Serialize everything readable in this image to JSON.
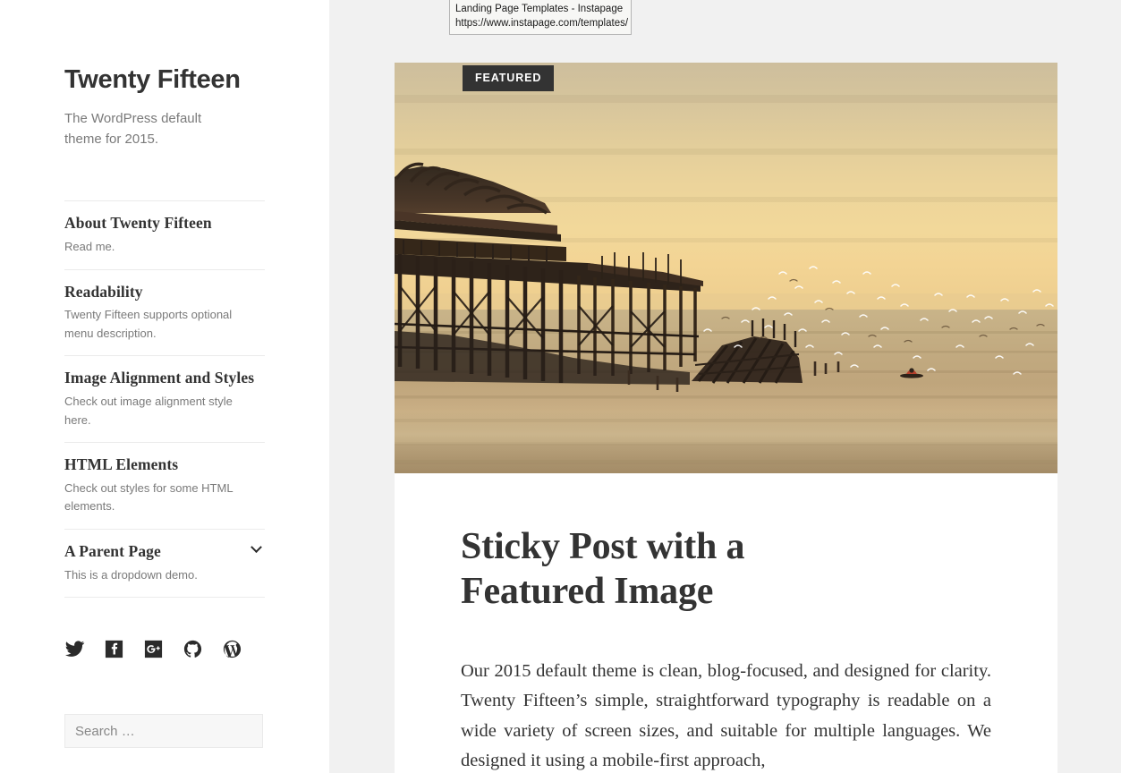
{
  "browser": {
    "tooltip": {
      "title": "Landing Page Templates - Instapage",
      "url": "https://www.instapage.com/templates/"
    }
  },
  "sidebar": {
    "site_title": "Twenty Fifteen",
    "site_description": "The WordPress default theme for 2015.",
    "nav_items": [
      {
        "label": "About Twenty Fifteen",
        "description": "Read me.",
        "has_dropdown": false
      },
      {
        "label": "Readability",
        "description": "Twenty Fifteen supports optional menu description.",
        "has_dropdown": false
      },
      {
        "label": "Image Alignment and Styles",
        "description": "Check out image alignment style here.",
        "has_dropdown": false
      },
      {
        "label": "HTML Elements",
        "description": "Check out styles for some HTML elements.",
        "has_dropdown": false
      },
      {
        "label": "A Parent Page",
        "description": "This is a dropdown demo.",
        "has_dropdown": true
      }
    ],
    "social_links": [
      {
        "name": "twitter",
        "label": "Twitter"
      },
      {
        "name": "facebook",
        "label": "Facebook"
      },
      {
        "name": "google-plus",
        "label": "Google Plus"
      },
      {
        "name": "github",
        "label": "GitHub"
      },
      {
        "name": "wordpress",
        "label": "WordPress"
      }
    ],
    "search": {
      "placeholder": "Search …",
      "value": ""
    }
  },
  "main": {
    "post": {
      "badge": "FEATURED",
      "title": "Sticky Post with a Featured Image",
      "excerpt": "Our 2015 default theme is clean, blog-focused, and designed for clarity. Twenty Fifteen’s simple, straightforward typography is readable on a wide variety of screen sizes, and suitable for multiple languages. We designed it using a mobile-first approach,",
      "featured_image_alt": "Silhouette of a derelict seaside pier at sunset with flocks of birds over the water"
    }
  },
  "colors": {
    "page_background": "#f1f1f1",
    "sidebar_background": "#ffffff",
    "card_background": "#ffffff",
    "text_primary": "#333333",
    "text_secondary": "#7a7a7a",
    "badge_background": "#333333",
    "divider": "#ebebeb",
    "search_background": "#f7f7f7"
  }
}
